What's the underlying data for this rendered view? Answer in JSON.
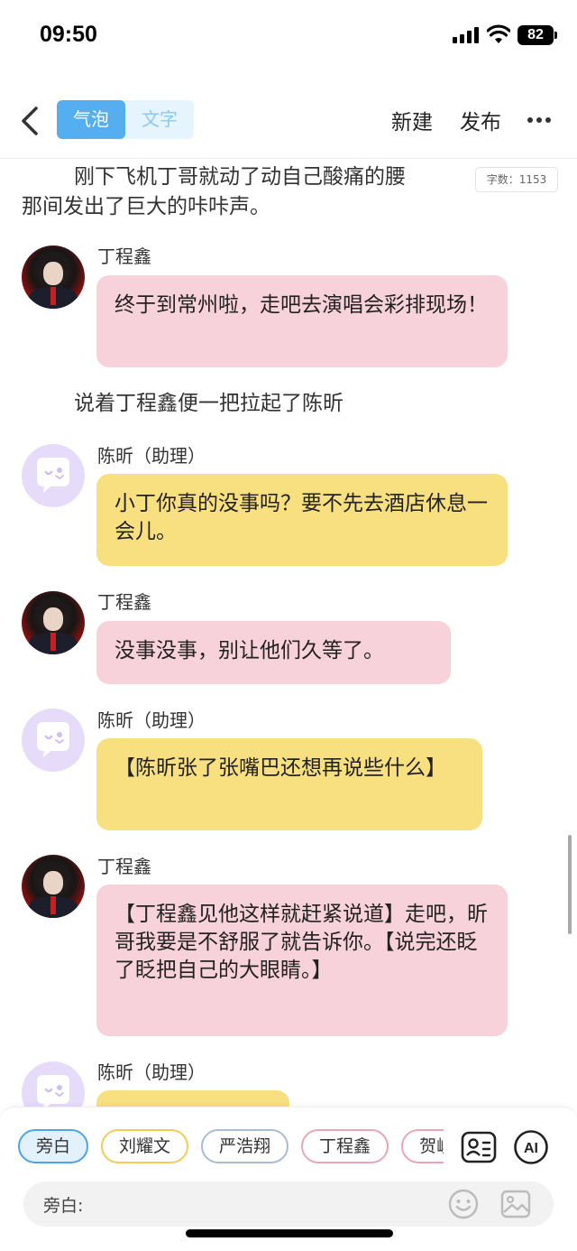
{
  "status_bar": {
    "time": "09:50",
    "battery": "82"
  },
  "nav": {
    "segments": [
      "气泡",
      "文字"
    ],
    "active_segment": 0,
    "new_label": "新建",
    "publish_label": "发布"
  },
  "word_count": "字数：1153",
  "content": {
    "intro_line1": "刚下飞机丁哥就动了动自己酸痛的腰",
    "intro_line2": "那间发出了巨大的咔咔声。",
    "narration1": "说着丁程鑫便一把拉起了陈昕",
    "messages": [
      {
        "speaker": "丁程鑫",
        "text": "终于到常州啦，走吧去演唱会彩排现场！",
        "color": "pink"
      },
      {
        "speaker": "陈昕（助理）",
        "text": "小丁你真的没事吗？要不先去酒店休息一会儿。",
        "color": "yellow"
      },
      {
        "speaker": "丁程鑫",
        "text": "没事没事，别让他们久等了。",
        "color": "pink"
      },
      {
        "speaker": "陈昕（助理）",
        "text": "【陈昕张了张嘴巴还想再说些什么】",
        "color": "yellow"
      },
      {
        "speaker": "丁程鑫",
        "text": "【丁程鑫见他这样就赶紧说道】走吧，昕哥我要是不舒服了就告诉你。【说完还眨了眨把自己的大眼睛。】",
        "color": "pink"
      },
      {
        "speaker": "陈昕（助理）",
        "text": "",
        "color": "yellow"
      }
    ]
  },
  "bottom": {
    "chips": [
      "旁白",
      "刘耀文",
      "严浩翔",
      "丁程鑫",
      "贺峻"
    ],
    "selected_chip": 0,
    "ai_label": "AI",
    "input_label": "旁白:",
    "input_value": ""
  },
  "colors": {
    "accent": "#55aef0",
    "pink_bubble": "#f8d2da",
    "yellow_bubble": "#f8e080",
    "assistant_avatar": "#e6dcfa"
  }
}
